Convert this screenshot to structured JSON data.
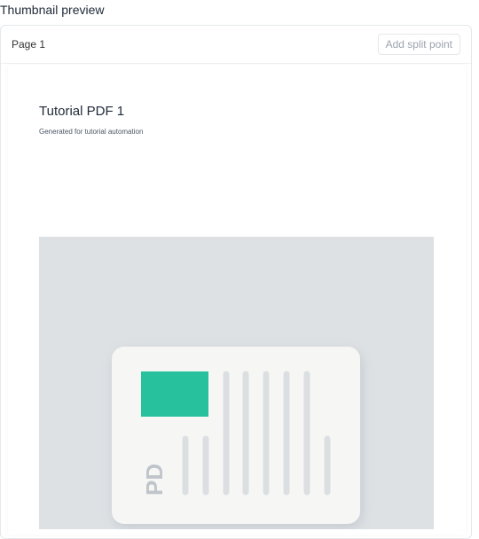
{
  "section": {
    "title": "Thumbnail preview"
  },
  "card": {
    "page_label": "Page 1",
    "split_button_label": "Add split point"
  },
  "document": {
    "title": "Tutorial PDF 1",
    "subtitle": "Generated for tutorial automation",
    "image": {
      "icon": "pdf-file-icon",
      "icon_text": "PD",
      "accent_color": "#27c29d",
      "background_color": "#dde1e4"
    }
  }
}
